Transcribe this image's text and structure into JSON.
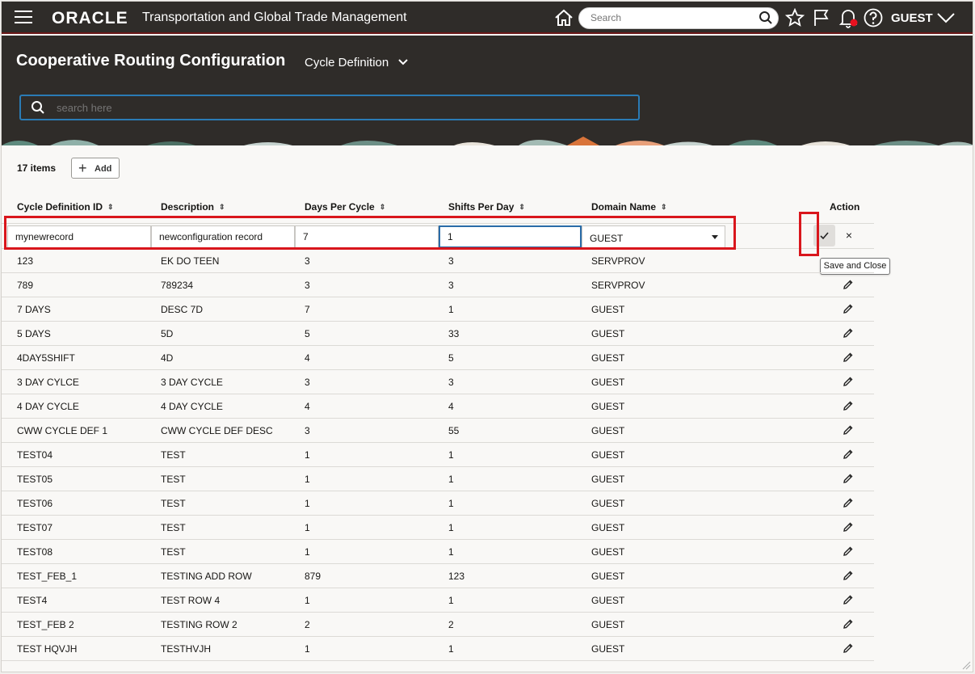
{
  "topbar": {
    "brand": "ORACLE",
    "product": "Transportation and Global Trade Management",
    "search_placeholder": "Search",
    "user": "GUEST",
    "icons": [
      "menu-icon",
      "home-icon",
      "search-icon",
      "star-icon",
      "flag-icon",
      "bell-icon",
      "help-icon",
      "chevron-down-icon"
    ],
    "bell_badge_color": "#e8111f"
  },
  "header": {
    "title": "Cooperative Routing Configuration",
    "subtitle": "Cycle Definition",
    "search_placeholder": "search here"
  },
  "list": {
    "count": "17 items",
    "add_label": "Add",
    "columns": [
      "Cycle Definition ID",
      "Description",
      "Days Per Cycle",
      "Shifts Per Day",
      "Domain Name",
      "Action"
    ]
  },
  "edit_row": {
    "id": "mynewrecord",
    "description": "newconfiguration record",
    "days": "7",
    "shifts": "1",
    "domain": "GUEST",
    "save_tooltip": "Save and Close",
    "cancel_symbol": "×",
    "save_symbol": "✓"
  },
  "rows": [
    {
      "id": "123",
      "description": "EK DO TEEN",
      "days": "3",
      "shifts": "3",
      "domain": "SERVPROV"
    },
    {
      "id": "789",
      "description": "789234",
      "days": "3",
      "shifts": "3",
      "domain": "SERVPROV"
    },
    {
      "id": "7 DAYS",
      "description": "DESC 7D",
      "days": "7",
      "shifts": "1",
      "domain": "GUEST"
    },
    {
      "id": "5 DAYS",
      "description": "5D",
      "days": "5",
      "shifts": "33",
      "domain": "GUEST"
    },
    {
      "id": "4DAY5SHIFT",
      "description": "4D",
      "days": "4",
      "shifts": "5",
      "domain": "GUEST"
    },
    {
      "id": "3 DAY CYLCE",
      "description": "3 DAY CYCLE",
      "days": "3",
      "shifts": "3",
      "domain": "GUEST"
    },
    {
      "id": "4 DAY CYCLE",
      "description": "4 DAY CYCLE",
      "days": "4",
      "shifts": "4",
      "domain": "GUEST"
    },
    {
      "id": "CWW CYCLE DEF 1",
      "description": "CWW CYCLE DEF DESC",
      "days": "3",
      "shifts": "55",
      "domain": "GUEST"
    },
    {
      "id": "TEST04",
      "description": "TEST",
      "days": "1",
      "shifts": "1",
      "domain": "GUEST"
    },
    {
      "id": "TEST05",
      "description": "TEST",
      "days": "1",
      "shifts": "1",
      "domain": "GUEST"
    },
    {
      "id": "TEST06",
      "description": "TEST",
      "days": "1",
      "shifts": "1",
      "domain": "GUEST"
    },
    {
      "id": "TEST07",
      "description": "TEST",
      "days": "1",
      "shifts": "1",
      "domain": "GUEST"
    },
    {
      "id": "TEST08",
      "description": "TEST",
      "days": "1",
      "shifts": "1",
      "domain": "GUEST"
    },
    {
      "id": "TEST_FEB_1",
      "description": "TESTING ADD ROW",
      "days": "879",
      "shifts": "123",
      "domain": "GUEST"
    },
    {
      "id": "TEST4",
      "description": "TEST ROW 4",
      "days": "1",
      "shifts": "1",
      "domain": "GUEST"
    },
    {
      "id": "TEST_FEB 2",
      "description": "TESTING ROW 2",
      "days": "2",
      "shifts": "2",
      "domain": "GUEST"
    },
    {
      "id": "TEST HQVJH",
      "description": "TESTHVJH",
      "days": "1",
      "shifts": "1",
      "domain": "GUEST"
    }
  ],
  "highlight_color": "#d9161c"
}
